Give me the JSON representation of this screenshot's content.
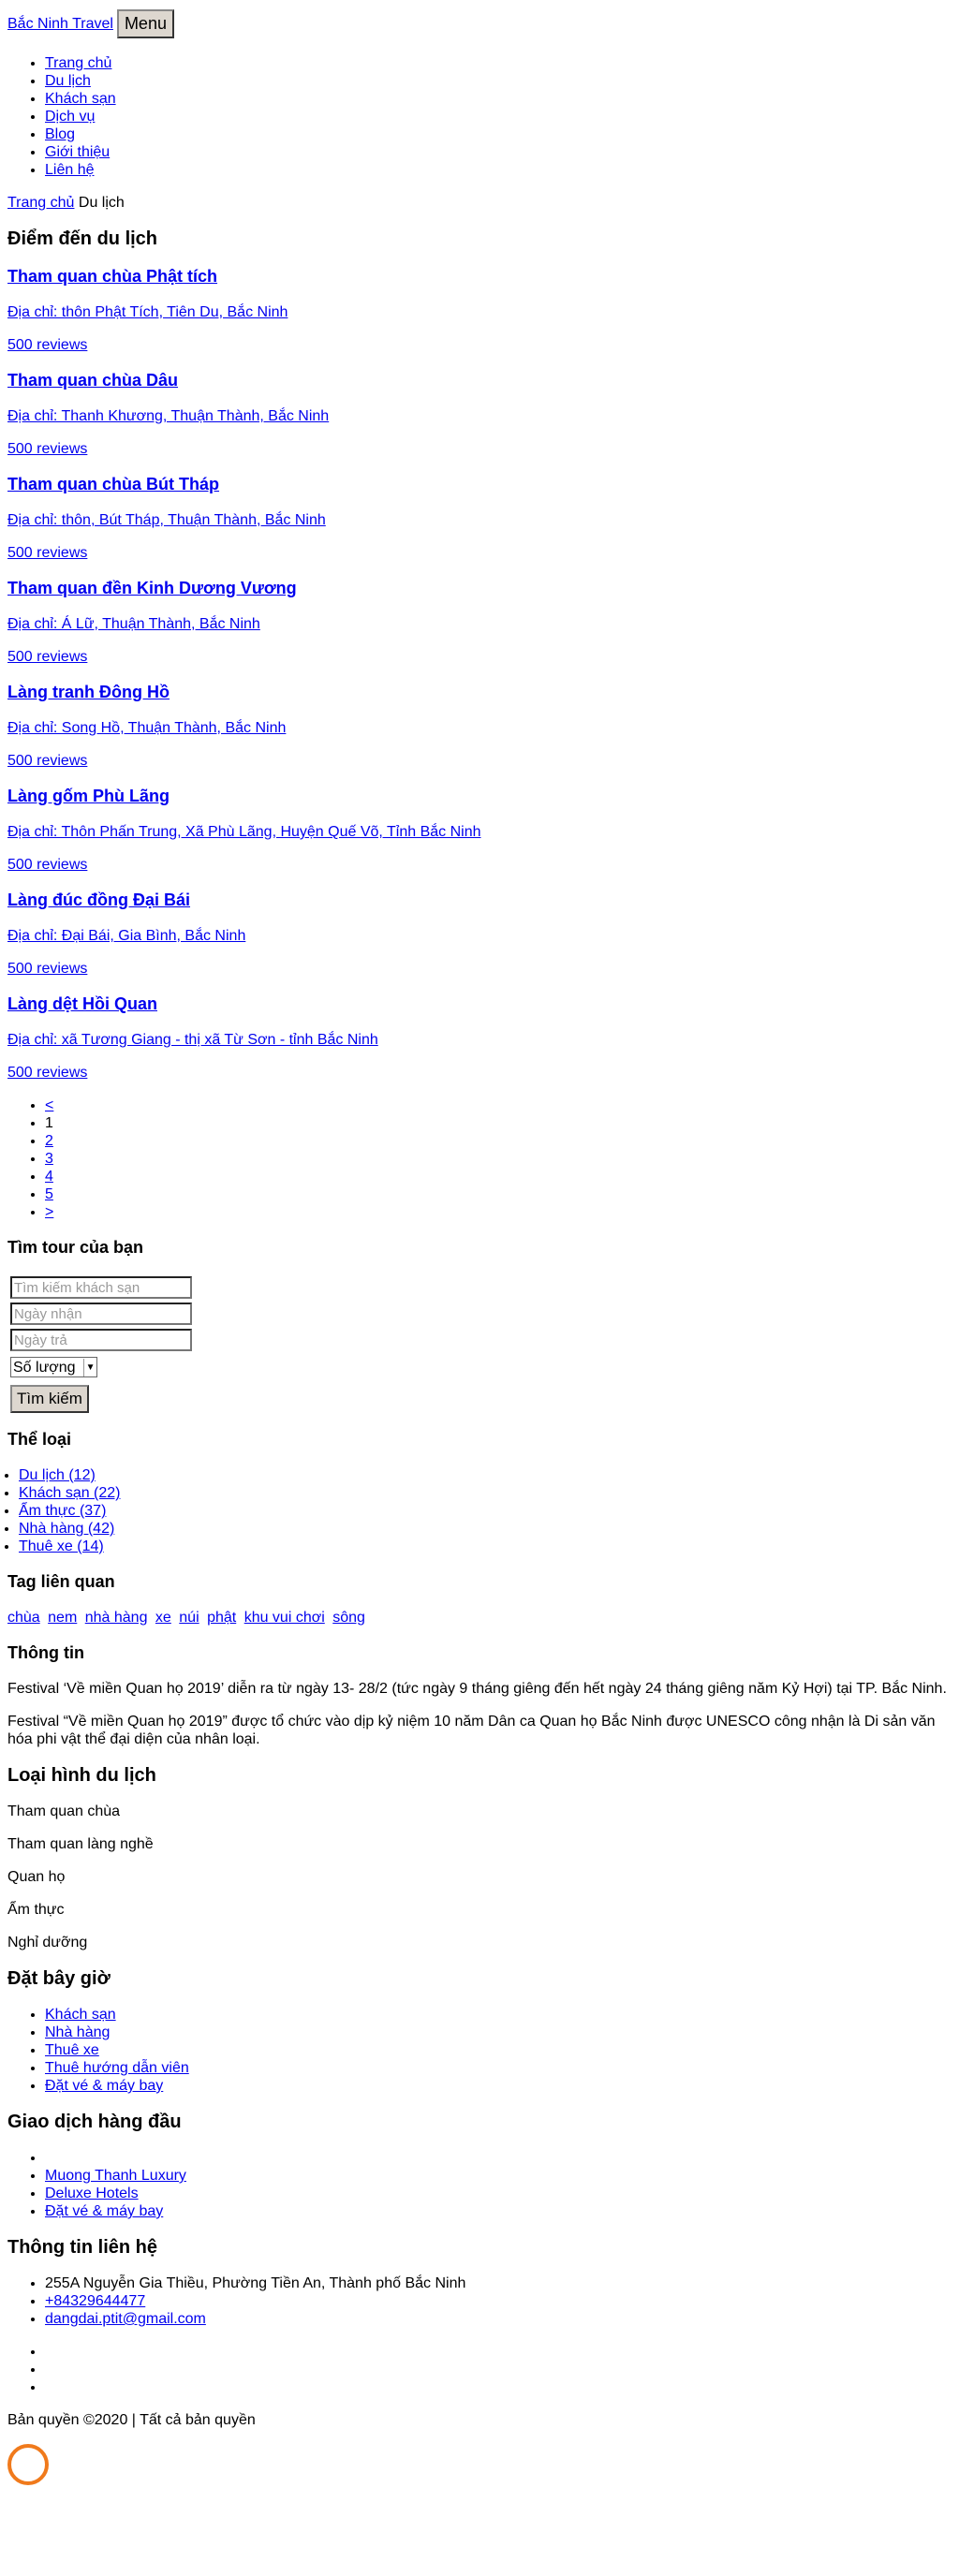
{
  "header": {
    "brand": "Bắc Ninh Travel",
    "menu_label": "Menu"
  },
  "nav": [
    "Trang chủ",
    "Du lịch",
    "Khách sạn",
    "Dịch vụ",
    "Blog",
    "Giới thiệu",
    "Liên hệ"
  ],
  "breadcrumb": {
    "home": "Trang chủ",
    "current": "Du lịch"
  },
  "page_title": "Điểm đến du lịch",
  "destinations": [
    {
      "title": "Tham quan chùa Phật tích",
      "address": "Địa chỉ: thôn Phật Tích, Tiên Du, Bắc Ninh",
      "reviews": "500 reviews"
    },
    {
      "title": "Tham quan chùa Dâu",
      "address": "Địa chỉ: Thanh Khương, Thuận Thành, Bắc Ninh",
      "reviews": "500 reviews"
    },
    {
      "title": "Tham quan chùa Bút Tháp",
      "address": "Địa chỉ: thôn, Bút Tháp, Thuận Thành, Bắc Ninh",
      "reviews": "500 reviews"
    },
    {
      "title": "Tham quan đền Kinh Dương Vương",
      "address": "Địa chỉ: Á Lữ, Thuận Thành, Bắc Ninh",
      "reviews": "500 reviews"
    },
    {
      "title": "Làng tranh Đông Hồ",
      "address": "Địa chỉ: Song Hồ, Thuận Thành, Bắc Ninh",
      "reviews": "500 reviews"
    },
    {
      "title": "Làng gốm Phù Lãng",
      "address": "Địa chỉ: Thôn Phấn Trung, Xã Phù Lãng, Huyện Quế Võ, Tỉnh Bắc Ninh",
      "reviews": "500 reviews"
    },
    {
      "title": "Làng đúc đồng Đại Bái",
      "address": "Địa chỉ: Đại Bái, Gia Bình, Bắc Ninh",
      "reviews": "500 reviews"
    },
    {
      "title": "Làng dệt Hồi Quan",
      "address": "Địa chỉ: xã Tương Giang - thị xã Từ Sơn - tỉnh Bắc Ninh",
      "reviews": "500 reviews"
    }
  ],
  "pagination": {
    "prev": "<",
    "current": "1",
    "pages": [
      "2",
      "3",
      "4",
      "5"
    ],
    "next": ">"
  },
  "search": {
    "title": "Tìm tour của bạn",
    "keyword_placeholder": "Tìm kiếm khách sạn",
    "checkin_placeholder": "Ngày nhận",
    "checkout_placeholder": "Ngày trả",
    "quantity_label": "Số lượng",
    "button": "Tìm kiếm"
  },
  "categories": {
    "title": "Thể loại",
    "items": [
      "Du lịch (12)",
      "Khách sạn (22)",
      "Ẩm thực (37)",
      "Nhà hàng (42)",
      "Thuê xe (14)"
    ]
  },
  "tags": {
    "title": "Tag liên quan",
    "items": [
      "chùa",
      "nem",
      "nhà hàng",
      "xe",
      "núi",
      "phật",
      "khu vui chơi",
      "sông"
    ]
  },
  "info": {
    "title": "Thông tin",
    "paragraphs": [
      "Festival ‘Về miền Quan họ 2019’ diễn ra từ ngày 13- 28/2 (tức ngày 9 tháng giêng đến hết ngày 24 tháng giêng năm Kỷ Hợi) tại TP. Bắc Ninh.",
      "Festival “Về miền Quan họ 2019” được tổ chức vào dịp kỷ niệm 10 năm Dân ca Quan họ Bắc Ninh được UNESCO công nhận là Di sản văn hóa phi vật thể đại diện của nhân loại."
    ]
  },
  "tour_types": {
    "title": "Loại hình du lịch",
    "items": [
      "Tham quan chùa",
      "Tham quan làng nghề",
      "Quan họ",
      "Ẩm thực",
      "Nghỉ dưỡng"
    ]
  },
  "book_now": {
    "title": "Đặt bây giờ",
    "items": [
      "Khách sạn",
      "Nhà hàng",
      "Thuê xe",
      "Thuê hướng dẫn viên",
      "Đặt vé & máy bay"
    ]
  },
  "top_deals": {
    "title": "Giao dịch hàng đầu",
    "items": [
      "",
      "Muong Thanh Luxury",
      "Deluxe Hotels",
      "Đặt vé & máy bay"
    ]
  },
  "contact": {
    "title": "Thông tin liên hệ",
    "address": "255A Nguyễn Gia Thiều, Phường Tiền An, Thành phố Bắc Ninh",
    "phone": "+84329644477",
    "email": "dangdai.ptit@gmail.com"
  },
  "footer": {
    "copyright": "Bản quyền ©2020 | Tất cả bản quyền"
  },
  "colors": {
    "link": "#0000ee",
    "accent_circle": "#f07a1c",
    "button_bg": "#ddd7cf"
  }
}
